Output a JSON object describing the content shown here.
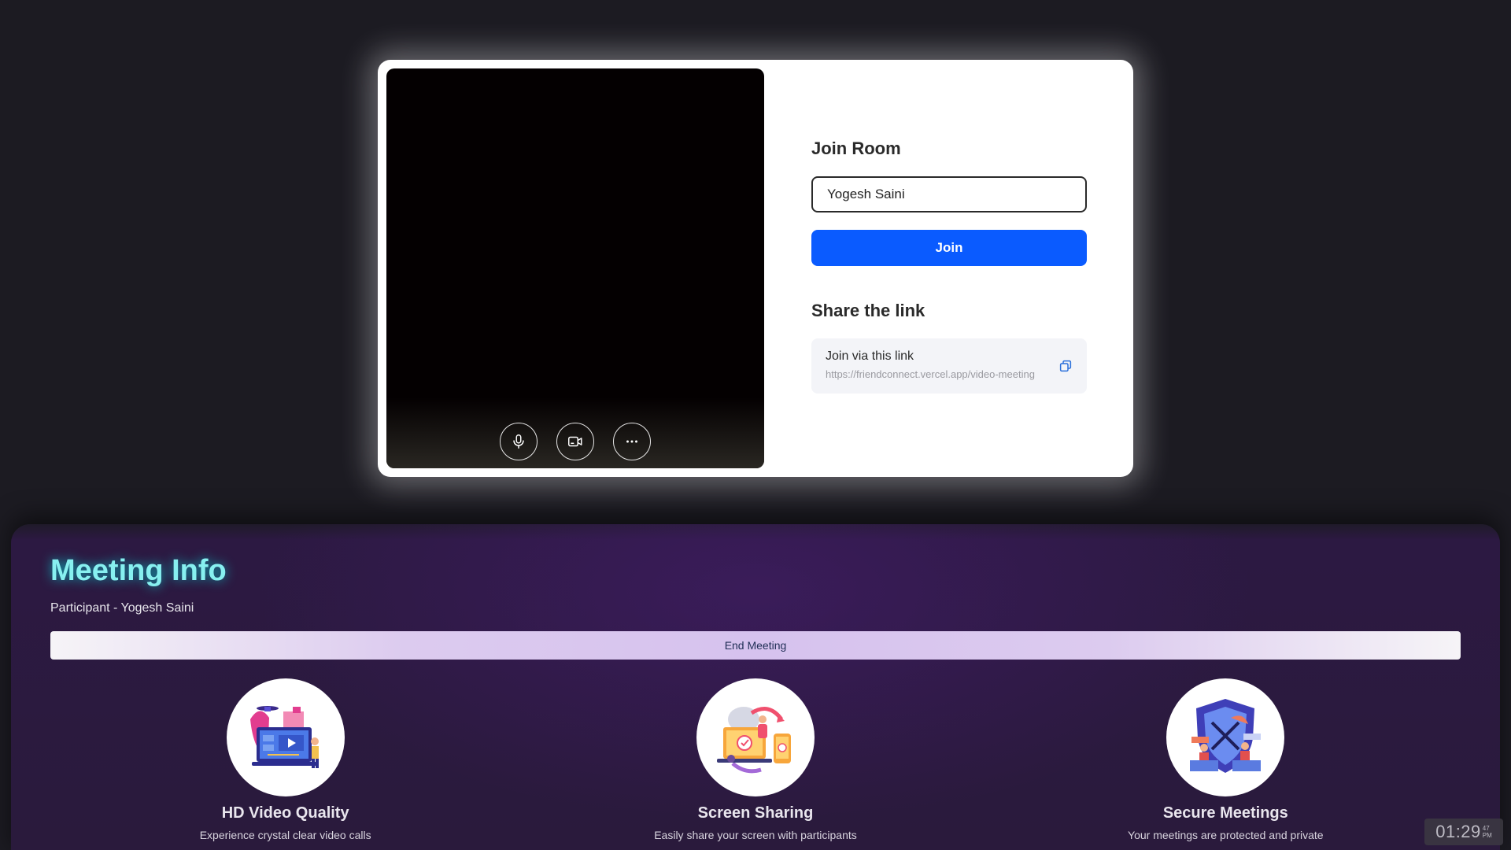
{
  "join": {
    "heading": "Join Room",
    "name_value": "Yogesh Saini",
    "join_label": "Join"
  },
  "share": {
    "heading": "Share the link",
    "link_title": "Join via this link",
    "link_url": "https://friendconnect.vercel.app/video-meeting"
  },
  "controls": {
    "icons": [
      "microphone-icon",
      "video-camera-icon",
      "more-options-icon"
    ]
  },
  "meeting_info": {
    "title": "Meeting Info",
    "participant": "Participant - Yogesh Saini",
    "end_label": "End Meeting",
    "features": [
      {
        "title": "HD Video Quality",
        "description": "Experience crystal clear video calls"
      },
      {
        "title": "Screen Sharing",
        "description": "Easily share your screen with participants"
      },
      {
        "title": "Secure Meetings",
        "description": "Your meetings are protected and private"
      }
    ]
  },
  "clock": {
    "time": "01:29",
    "seconds": "47",
    "period": "PM"
  },
  "colors": {
    "primary": "#0a5bff",
    "title_glow": "#87f0f0",
    "card_bg": "#ffffff",
    "page_bg": "#1c1b22"
  }
}
